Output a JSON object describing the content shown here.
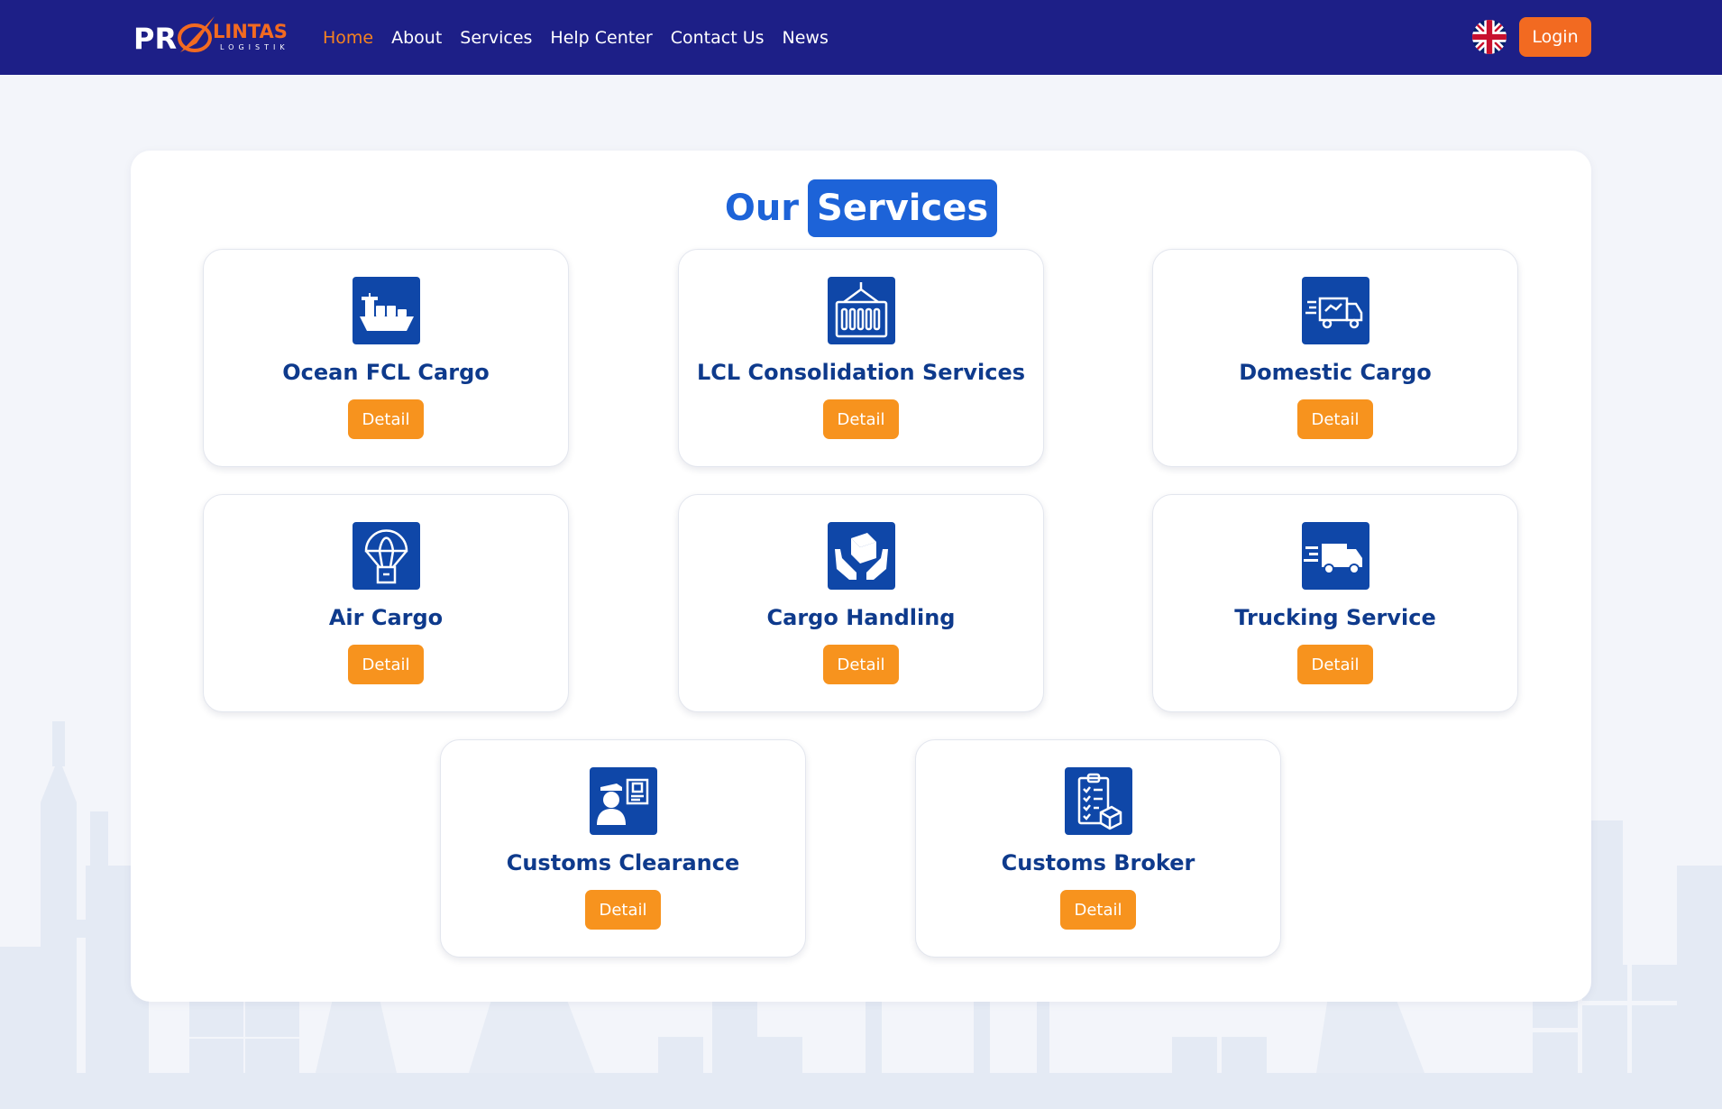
{
  "brand": {
    "logo_text_pro": "PR",
    "logo_text_lintas": "LINTAS",
    "logo_text_logistik": "LOGISTIK"
  },
  "nav": {
    "items": [
      {
        "label": "Home",
        "active": true
      },
      {
        "label": "About",
        "active": false
      },
      {
        "label": "Services",
        "active": false
      },
      {
        "label": "Help Center",
        "active": false
      },
      {
        "label": "Contact Us",
        "active": false
      },
      {
        "label": "News",
        "active": false
      }
    ],
    "language_icon": "uk-flag-icon",
    "login_label": "Login"
  },
  "section": {
    "title_part1": "Our",
    "title_part2": "Services"
  },
  "services": [
    {
      "name": "Ocean FCL Cargo",
      "icon": "cargo-ship-icon",
      "button": "Detail"
    },
    {
      "name": "LCL Consolidation Services",
      "icon": "container-icon",
      "button": "Detail"
    },
    {
      "name": "Domestic Cargo",
      "icon": "delivery-truck-icon",
      "button": "Detail"
    },
    {
      "name": "Air Cargo",
      "icon": "parachute-package-icon",
      "button": "Detail"
    },
    {
      "name": "Cargo Handling",
      "icon": "hands-box-icon",
      "button": "Detail"
    },
    {
      "name": "Trucking Service",
      "icon": "fast-truck-icon",
      "button": "Detail"
    },
    {
      "name": "Customs Clearance",
      "icon": "customs-officer-icon",
      "button": "Detail"
    },
    {
      "name": "Customs Broker",
      "icon": "clipboard-checklist-icon",
      "button": "Detail"
    }
  ],
  "colors": {
    "navbar": "#1d1f87",
    "accent_orange": "#f26a21",
    "detail_button": "#f7931e",
    "title_blue": "#1d63d8",
    "icon_bg": "#0f47a8",
    "service_name": "#0e3a8c"
  }
}
